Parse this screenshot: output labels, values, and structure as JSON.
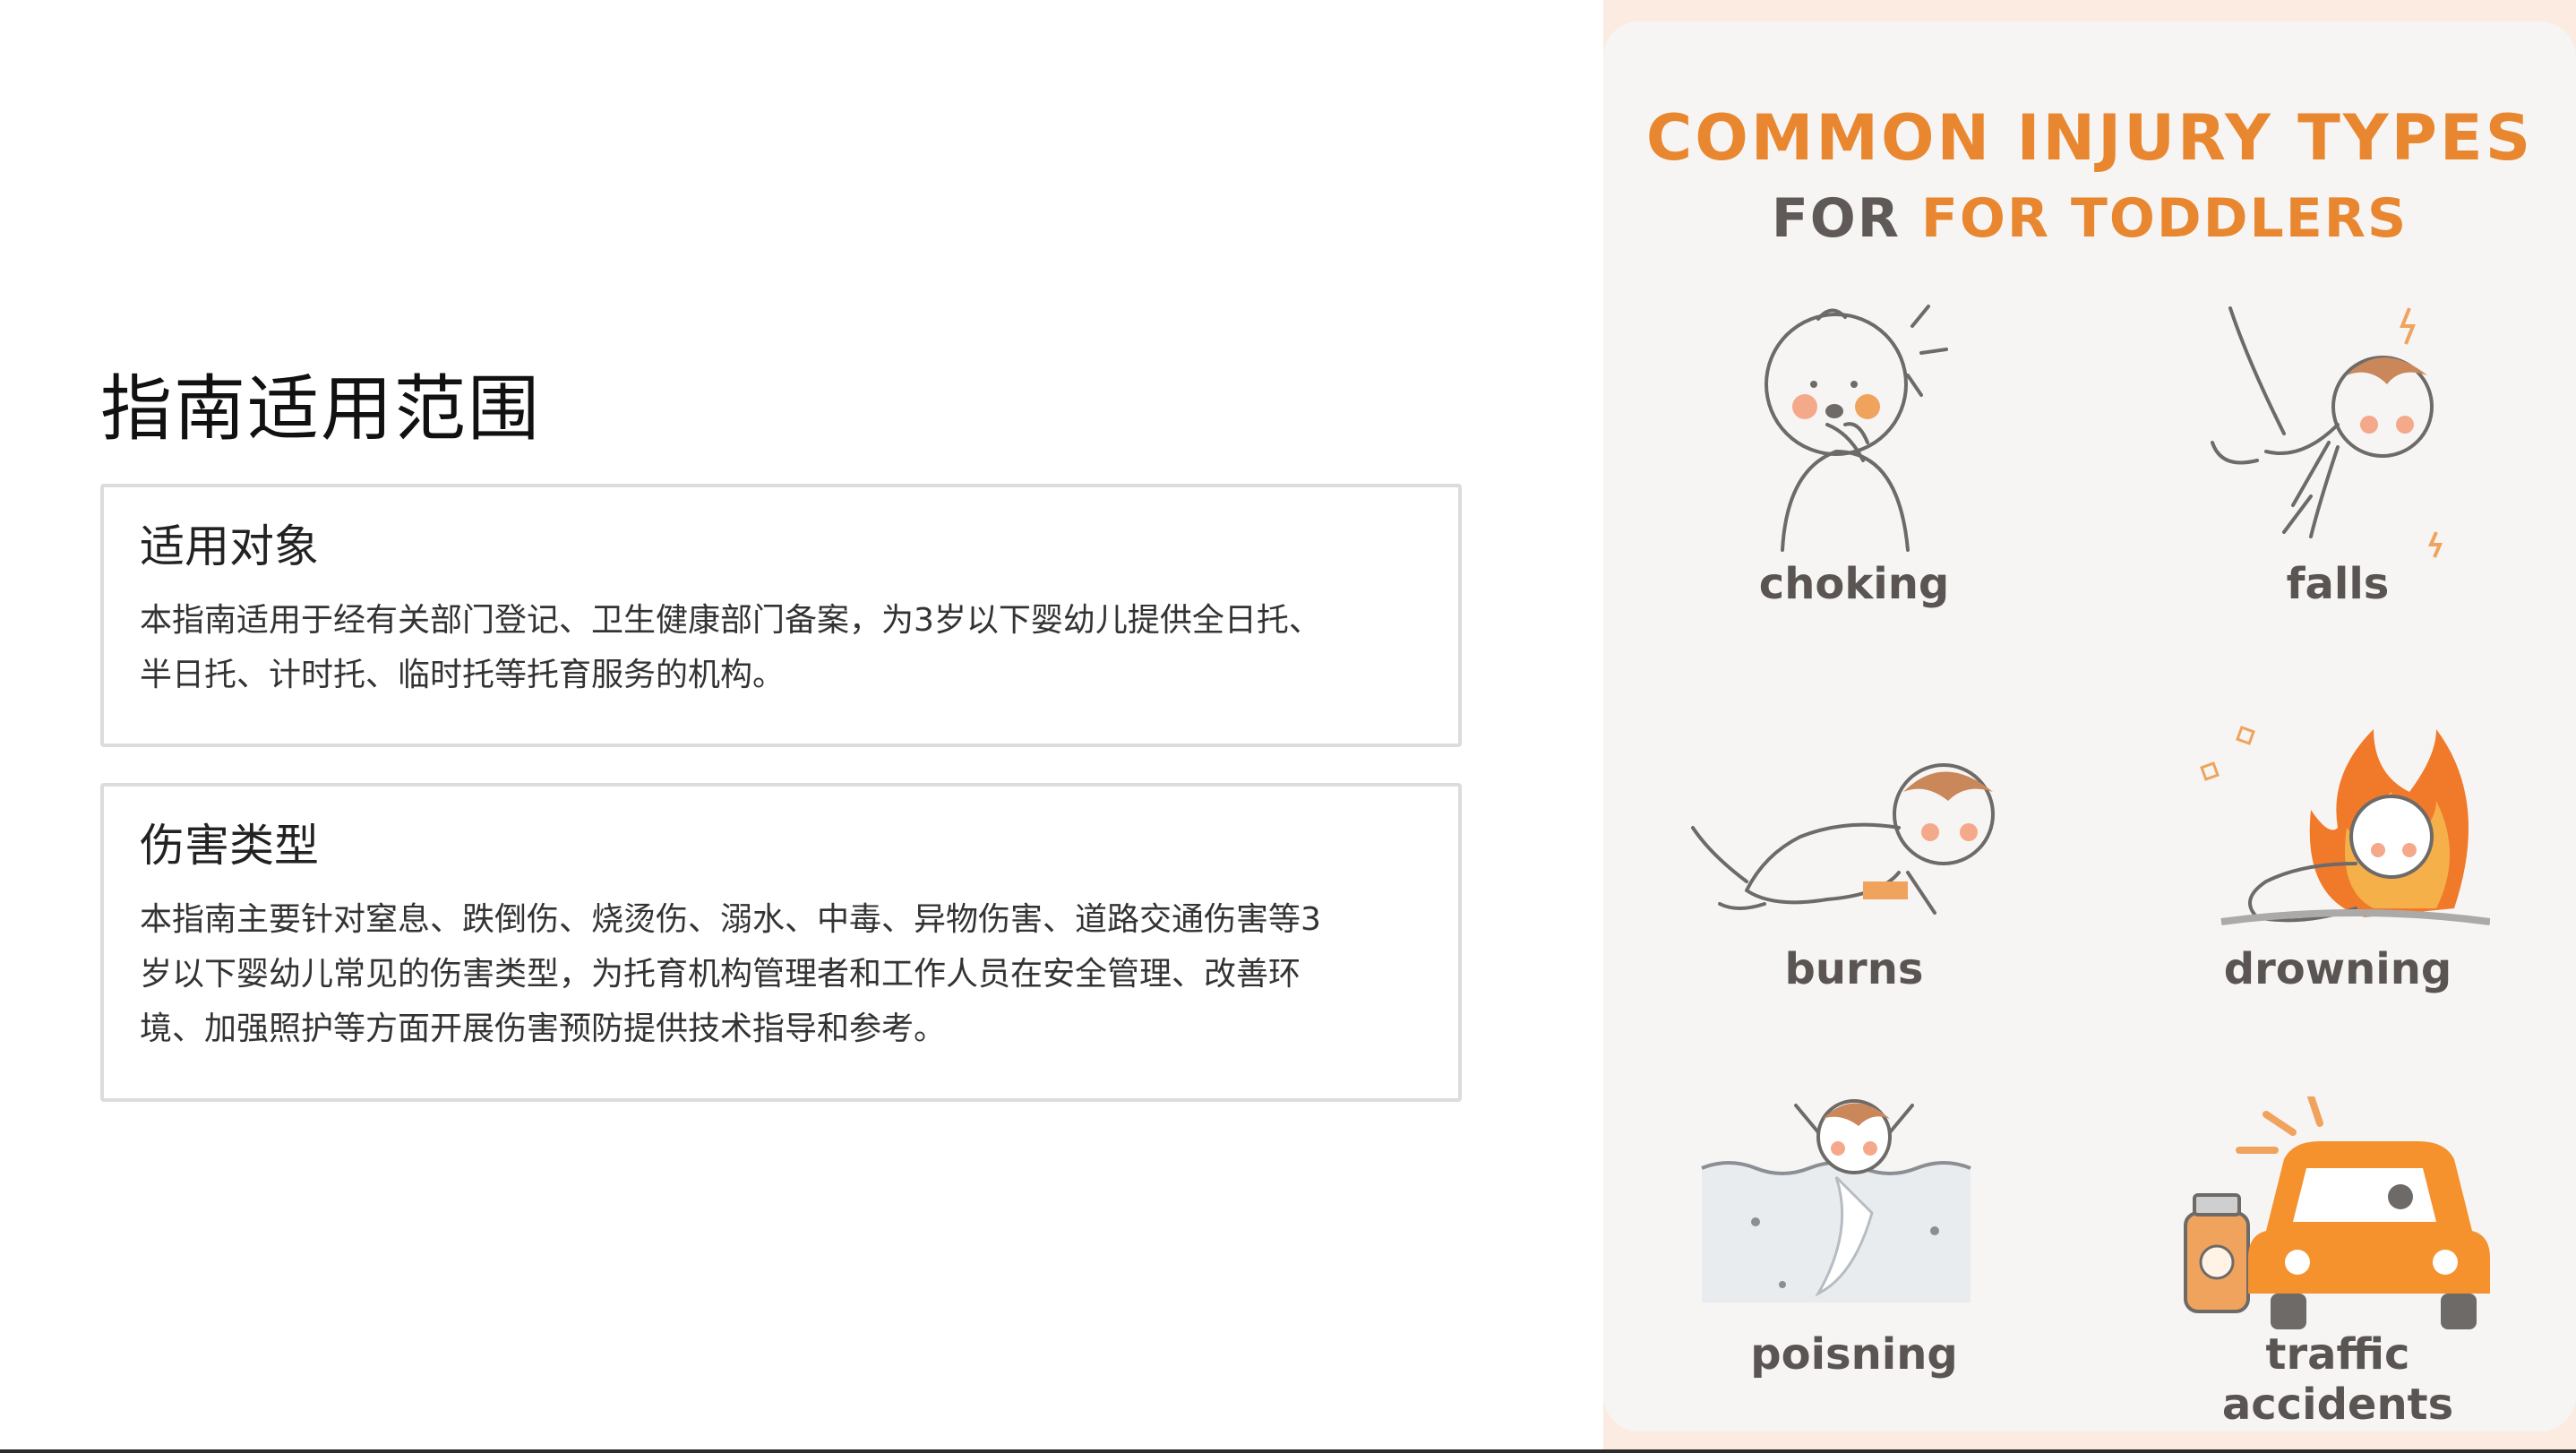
{
  "scope_heading": "指南适用范围",
  "sections": [
    {
      "title": "适用对象",
      "lines": [
        "本指南适用于经有关部门登记、卫生健康部门备案，为3岁以下婴幼儿提供全日托、",
        "半日托、计时托、临时托等托育服务的机构。"
      ]
    },
    {
      "title": "伤害类型",
      "lines": [
        "本指南主要针对窒息、跌倒伤、烧烫伤、溺水、中毒、异物伤害、道路交通伤害等3",
        "岁以下婴幼儿常见的伤害类型，为托育机构管理者和工作人员在安全管理、改善环",
        "境、加强照护等方面开展伤害预防提供技术指导和参考。"
      ]
    }
  ],
  "poster": {
    "title": "COMMON INJURY TYPES",
    "subtitle_prefix": "FOR",
    "subtitle_highlight": "FOR TODDLERS",
    "items": [
      {
        "label": "choking",
        "icon": "choking-toddler-icon"
      },
      {
        "label": "falls",
        "icon": "falling-toddler-icon"
      },
      {
        "label": "burns",
        "icon": "crawling-toddler-icon"
      },
      {
        "label": "drowning",
        "icon": "toddler-on-fire-icon"
      },
      {
        "label": "poisning",
        "icon": "toddler-in-water-icon"
      },
      {
        "label": "traffic",
        "icon": "car-and-poison-bottle-icon"
      },
      {
        "label": "accidents"
      }
    ],
    "colors": {
      "accent": "#e8872f",
      "flame": "#f07a2a",
      "skin_blush": "#f4a98a",
      "line": "#6d6a68",
      "background": "#fcebe1"
    }
  }
}
